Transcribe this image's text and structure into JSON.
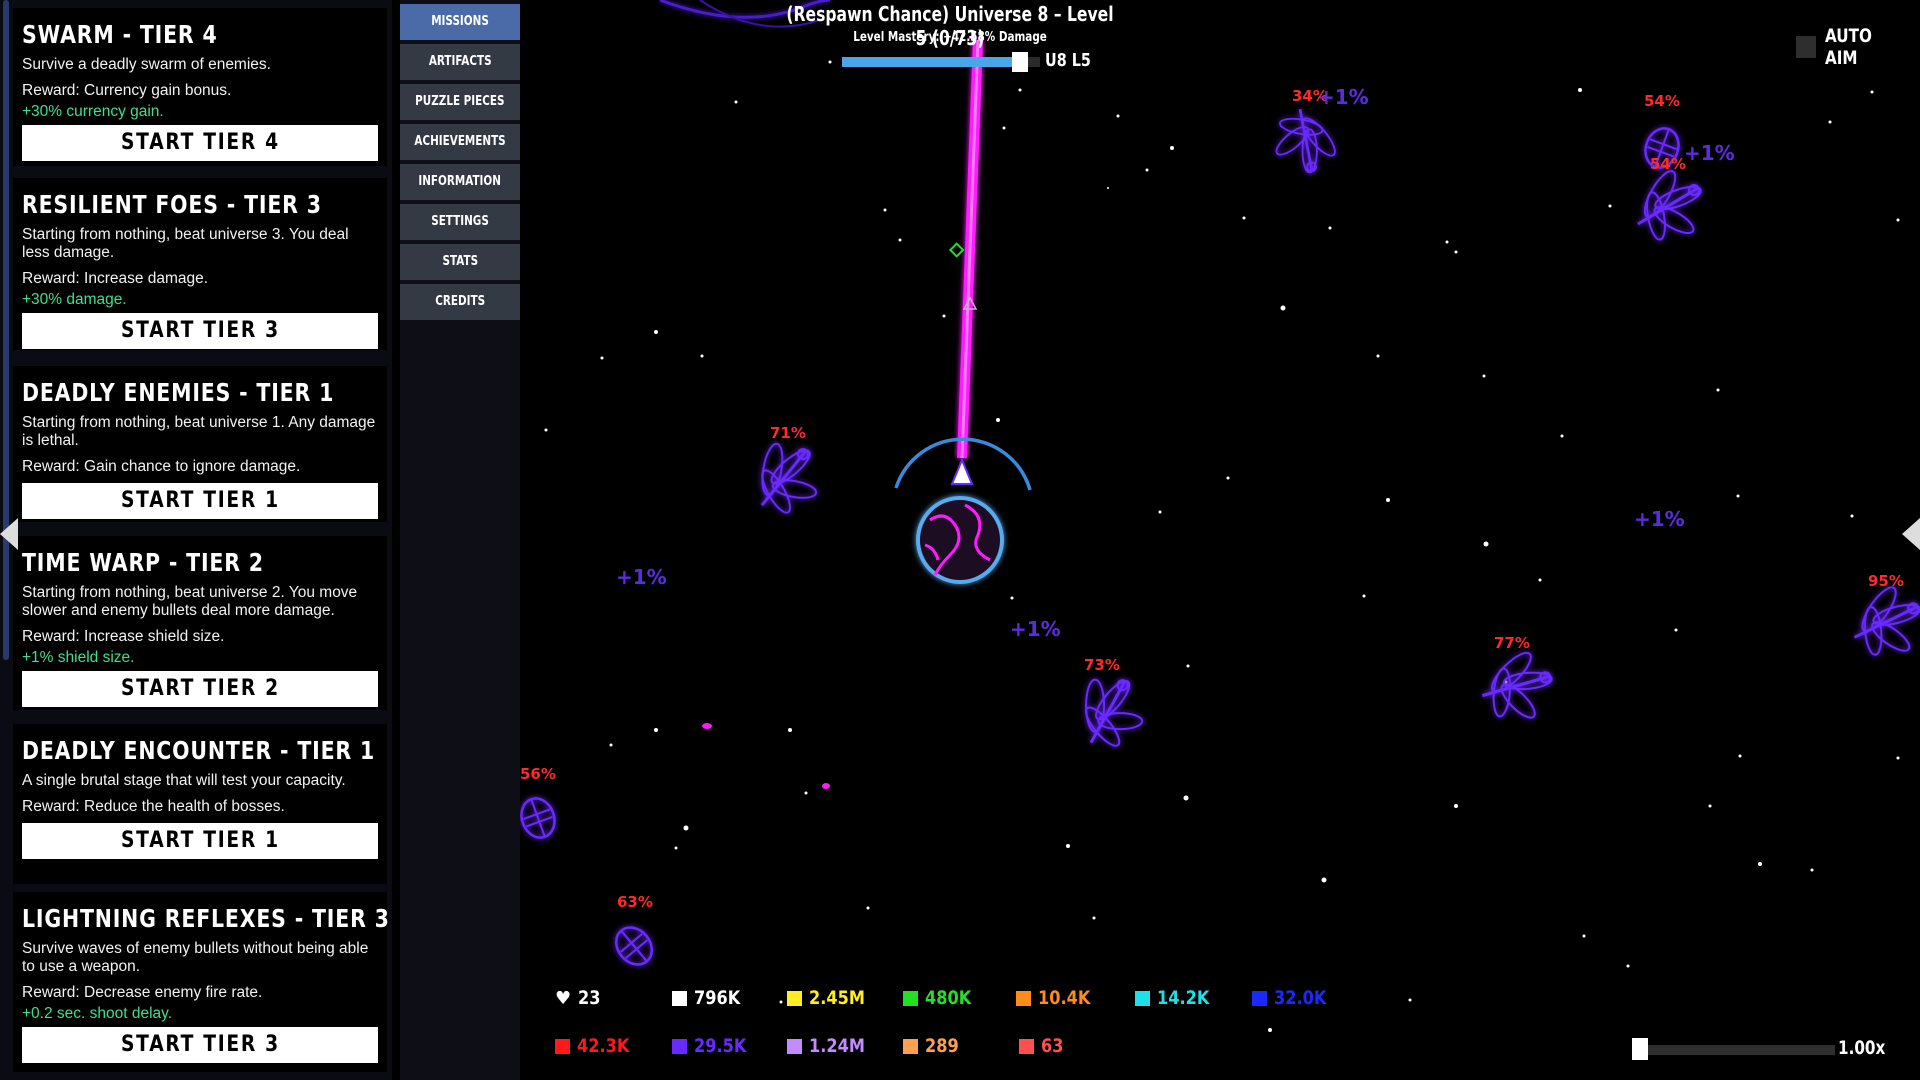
{
  "missions": [
    {
      "title": "SWARM - TIER 4",
      "desc": "Survive a deadly swarm of enemies.",
      "reward": "Reward: Currency gain bonus.",
      "bonus": "+30% currency gain.",
      "button": "START TIER 4"
    },
    {
      "title": "RESILIENT FOES - TIER 3",
      "desc": "Starting from nothing, beat universe 3. You deal less damage.",
      "reward": "Reward: Increase damage.",
      "bonus": "+30% damage.",
      "button": "START TIER 3"
    },
    {
      "title": "DEADLY ENEMIES - TIER 1",
      "desc": "Starting from nothing, beat universe 1. Any damage is lethal.",
      "reward": "Reward: Gain chance to ignore damage.",
      "bonus": "",
      "button": "START TIER 1"
    },
    {
      "title": "TIME WARP - TIER 2",
      "desc": "Starting from nothing, beat universe 2. You move slower and enemy bullets deal more damage.",
      "reward": "Reward: Increase shield size.",
      "bonus": "+1% shield size.",
      "button": "START TIER 2"
    },
    {
      "title": "DEADLY ENCOUNTER - TIER 1",
      "desc": "A single brutal stage that will test your capacity.",
      "reward": "Reward: Reduce the health of bosses.",
      "bonus": "",
      "button": "START TIER 1"
    },
    {
      "title": "LIGHTNING REFLEXES - TIER 3",
      "desc": "Survive waves of enemy bullets without being able to use a weapon.",
      "reward": "Reward: Decrease enemy fire rate.",
      "bonus": "+0.2 sec. shoot delay.",
      "button": "START TIER 3"
    }
  ],
  "nav": [
    "MISSIONS",
    "ARTIFACTS",
    "PUZZLE PIECES",
    "ACHIEVEMENTS",
    "INFORMATION",
    "SETTINGS",
    "STATS",
    "CREDITS"
  ],
  "hud": {
    "title": "(Respawn Chance) Universe 8 – Level 5 (0/73)",
    "mastery": "Level Mastery: +42.58% Damage",
    "mastery_progress": 0.9,
    "level_tag": "U8 L5",
    "auto_aim": "AUTO AIM"
  },
  "enemies": [
    {
      "pct": "34%"
    },
    {
      "pct": "54%"
    },
    {
      "pct": "54%"
    },
    {
      "pct": "71%"
    },
    {
      "pct": "73%"
    },
    {
      "pct": "77%"
    },
    {
      "pct": "95%"
    },
    {
      "pct": "56%"
    },
    {
      "pct": "63%"
    }
  ],
  "bonus_labels": [
    "+1%",
    "+1%",
    "+1%",
    "+1%",
    "+1%"
  ],
  "resources_row1": [
    {
      "icon": "heart-icon",
      "color": "#ffffff",
      "value": "23"
    },
    {
      "icon": "square-icon",
      "color": "#ffffff",
      "value": "796K"
    },
    {
      "icon": "square-icon",
      "color": "#ffee22",
      "value": "2.45M"
    },
    {
      "icon": "square-icon",
      "color": "#22e022",
      "value": "480K"
    },
    {
      "icon": "square-icon",
      "color": "#ff8c1a",
      "value": "10.4K"
    },
    {
      "icon": "square-icon",
      "color": "#1ee0e6",
      "value": "14.2K"
    },
    {
      "icon": "square-icon",
      "color": "#1a2aff",
      "value": "32.0K"
    }
  ],
  "resources_row2": [
    {
      "icon": "square-icon",
      "color": "#ff1a1a",
      "value": "42.3K"
    },
    {
      "icon": "square-icon",
      "color": "#6a2aff",
      "value": "29.5K"
    },
    {
      "icon": "square-icon",
      "color": "#c48aff",
      "value": "1.24M"
    },
    {
      "icon": "square-icon",
      "color": "#ffa050",
      "value": "289"
    },
    {
      "icon": "square-icon",
      "color": "#ff5050",
      "value": "63"
    }
  ],
  "speed": {
    "label": "1.00x",
    "level": 0.0
  }
}
